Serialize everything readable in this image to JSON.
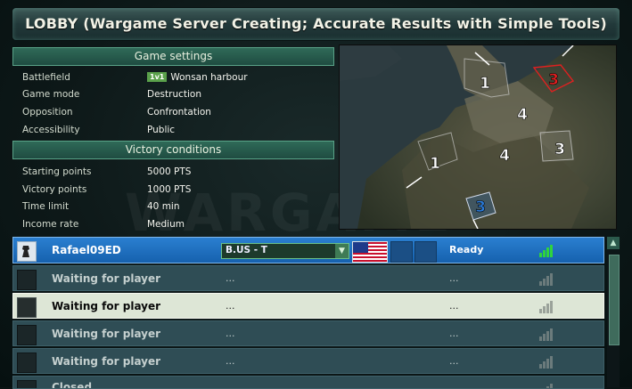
{
  "window": {
    "title": "LOBBY (Wargame Server Creating; Accurate Results with Simple Tools)"
  },
  "game_settings": {
    "header": "Game settings",
    "rows": [
      {
        "label": "Battlefield",
        "badge": "1v1",
        "value": "Wonsan harbour"
      },
      {
        "label": "Game mode",
        "value": "Destruction"
      },
      {
        "label": "Opposition",
        "value": "Confrontation"
      },
      {
        "label": "Accessibility",
        "value": "Public"
      }
    ]
  },
  "victory_conditions": {
    "header": "Victory conditions",
    "rows": [
      {
        "label": "Starting points",
        "value": "5000 PTS"
      },
      {
        "label": "Victory points",
        "value": "1000 PTS"
      },
      {
        "label": "Time limit",
        "value": "40 min"
      },
      {
        "label": "Income rate",
        "value": "Medium"
      }
    ]
  },
  "map": {
    "zones": [
      {
        "label": "1",
        "color": "#ffffff"
      },
      {
        "label": "3",
        "color": "#e02020"
      },
      {
        "label": "4",
        "color": "#ffffff"
      },
      {
        "label": "4",
        "color": "#ffffff"
      },
      {
        "label": "3",
        "color": "#ffffff"
      },
      {
        "label": "1",
        "color": "#ffffff"
      },
      {
        "label": "3",
        "color": "#2a7ad8"
      }
    ]
  },
  "players": {
    "host": {
      "name": "Rafael09ED",
      "deck": "B.US - T",
      "flag": "us-flag-icon",
      "status": "Ready",
      "signal_bars": 4
    },
    "rows": [
      {
        "name": "Waiting for player",
        "deck": "...",
        "status": "..."
      },
      {
        "name": "Waiting for player",
        "deck": "...",
        "status": "..."
      },
      {
        "name": "Waiting for player",
        "deck": "...",
        "status": "..."
      },
      {
        "name": "Waiting for player",
        "deck": "...",
        "status": "..."
      },
      {
        "name": "Closed",
        "deck": "",
        "status": ""
      }
    ]
  },
  "colors": {
    "accent": "#1e6fc0",
    "highlight_row": "#dde6d6",
    "ready_signal": "#2fd43c"
  }
}
